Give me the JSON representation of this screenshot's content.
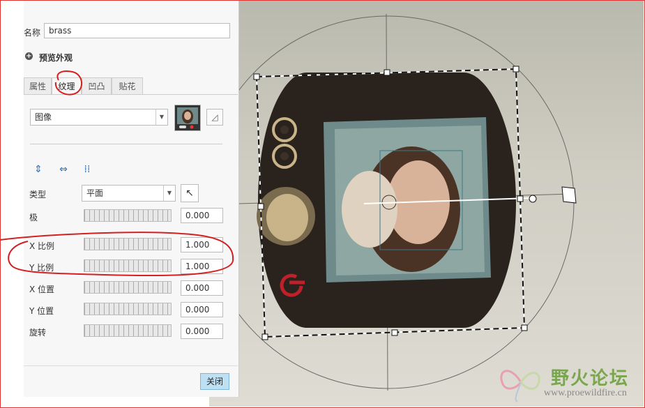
{
  "panel": {
    "name_label": "名称",
    "name_value": "brass",
    "preview_label": "预览外观",
    "tabs": [
      {
        "label": "属性",
        "active": false
      },
      {
        "label": "纹理",
        "active": true
      },
      {
        "label": "凹凸",
        "active": false
      },
      {
        "label": "贴花",
        "active": false
      }
    ],
    "texture_source": "图像",
    "fields": {
      "type_label": "类型",
      "type_value": "平面",
      "pole_label": "极",
      "pole_value": "0.000",
      "xscale_label": "X 比例",
      "xscale_value": "1.000",
      "yscale_label": "Y 比例",
      "yscale_value": "1.000",
      "xpos_label": "X 位置",
      "xpos_value": "0.000",
      "ypos_label": "Y 位置",
      "ypos_value": "0.000",
      "rotate_label": "旋转",
      "rotate_value": "0.000"
    },
    "close_label": "关闭"
  },
  "icons": {
    "preview_toggle": "plus-icon",
    "vertical_map": "vertical-arrows-icon",
    "horizontal_map": "horizontal-arrows-icon",
    "grid_map": "grid-icon",
    "pointer": "pointer-icon",
    "eraser": "eraser-icon"
  },
  "watermark": {
    "title": "野火论坛",
    "url": "www.proewildfire.cn"
  },
  "colors": {
    "accent": "#7fb8d8",
    "annotation": "#d32020",
    "device_body": "#2a221c",
    "knob": "#c9b48a"
  }
}
